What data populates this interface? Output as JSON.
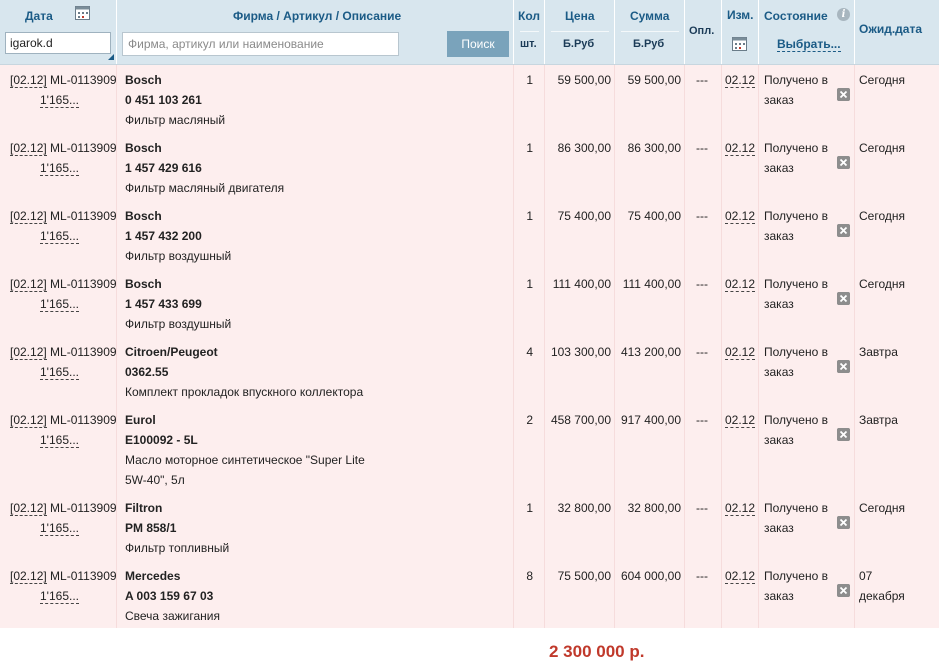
{
  "header": {
    "date": "Дата",
    "date_value": "igarok.d",
    "firm": "Фирма / Артикул / Описание",
    "search_placeholder": "Фирма, артикул или наименование",
    "search_button": "Поиск",
    "qty": "Кол",
    "qty_unit": "шт.",
    "price": "Цена",
    "price_unit": "Б.Руб",
    "sum": "Сумма",
    "sum_unit": "Б.Руб",
    "paid": "Опл.",
    "changed": "Изм.",
    "state": "Состояние",
    "state_choose": "Выбрать...",
    "expected": "Ожид.дата"
  },
  "rows": [
    {
      "date": "[02.12]",
      "order": "ML-0113909",
      "sub": "1'165...",
      "brand": "Bosch",
      "article": "0 451 103 261",
      "desc": [
        "Фильтр масляный"
      ],
      "qty": "1",
      "price": "59 500,00",
      "sum": "59 500,00",
      "paid": "---",
      "changed": "02.12",
      "state": "Получено в заказ",
      "expected": [
        "Сегодня"
      ]
    },
    {
      "date": "[02.12]",
      "order": "ML-0113909",
      "sub": "1'165...",
      "brand": "Bosch",
      "article": "1 457 429 616",
      "desc": [
        "Фильтр масляный двигателя"
      ],
      "qty": "1",
      "price": "86 300,00",
      "sum": "86 300,00",
      "paid": "---",
      "changed": "02.12",
      "state": "Получено в заказ",
      "expected": [
        "Сегодня"
      ]
    },
    {
      "date": "[02.12]",
      "order": "ML-0113909",
      "sub": "1'165...",
      "brand": "Bosch",
      "article": "1 457 432 200",
      "desc": [
        "Фильтр воздушный"
      ],
      "qty": "1",
      "price": "75 400,00",
      "sum": "75 400,00",
      "paid": "---",
      "changed": "02.12",
      "state": "Получено в заказ",
      "expected": [
        "Сегодня"
      ]
    },
    {
      "date": "[02.12]",
      "order": "ML-0113909",
      "sub": "1'165...",
      "brand": "Bosch",
      "article": "1 457 433 699",
      "desc": [
        "Фильтр воздушный"
      ],
      "qty": "1",
      "price": "111 400,00",
      "sum": "111 400,00",
      "paid": "---",
      "changed": "02.12",
      "state": "Получено в заказ",
      "expected": [
        "Сегодня"
      ]
    },
    {
      "date": "[02.12]",
      "order": "ML-0113909",
      "sub": "1'165...",
      "brand": "Citroen/Peugeot",
      "article": "0362.55",
      "desc": [
        "Комплект прокладок впускного коллектора"
      ],
      "qty": "4",
      "price": "103 300,00",
      "sum": "413 200,00",
      "paid": "---",
      "changed": "02.12",
      "state": "Получено в заказ",
      "expected": [
        "Завтра"
      ]
    },
    {
      "date": "[02.12]",
      "order": "ML-0113909",
      "sub": "1'165...",
      "brand": "Eurol",
      "article": "E100092 - 5L",
      "desc": [
        "Масло моторное синтетическое \"Super Lite",
        "5W-40\", 5л"
      ],
      "qty": "2",
      "price": "458 700,00",
      "sum": "917 400,00",
      "paid": "---",
      "changed": "02.12",
      "state": "Получено в заказ",
      "expected": [
        "Завтра"
      ]
    },
    {
      "date": "[02.12]",
      "order": "ML-0113909",
      "sub": "1'165...",
      "brand": "Filtron",
      "article": "PM 858/1",
      "desc": [
        "Фильтр топливный"
      ],
      "qty": "1",
      "price": "32 800,00",
      "sum": "32 800,00",
      "paid": "---",
      "changed": "02.12",
      "state": "Получено в заказ",
      "expected": [
        "Сегодня"
      ]
    },
    {
      "date": "[02.12]",
      "order": "ML-0113909",
      "sub": "1'165...",
      "brand": "Mercedes",
      "article": "A 003 159 67 03",
      "desc": [
        "Свеча зажигания"
      ],
      "qty": "8",
      "price": "75 500,00",
      "sum": "604 000,00",
      "paid": "---",
      "changed": "02.12",
      "state": "Получено в заказ",
      "expected": [
        "07",
        "декабря"
      ]
    }
  ],
  "total": "2 300 000 р.",
  "icons": [
    "calendar-icon",
    "info-icon",
    "remove-icon"
  ]
}
